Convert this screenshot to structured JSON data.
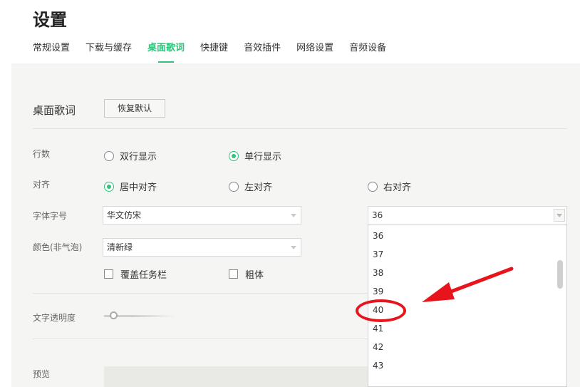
{
  "page_title": "设置",
  "tabs": [
    {
      "label": "常规设置"
    },
    {
      "label": "下载与缓存"
    },
    {
      "label": "桌面歌词"
    },
    {
      "label": "快捷键"
    },
    {
      "label": "音效插件"
    },
    {
      "label": "网络设置"
    },
    {
      "label": "音频设备"
    }
  ],
  "active_tab_index": 2,
  "section": {
    "title": "桌面歌词",
    "reset_button": "恢复默认"
  },
  "rows": {
    "line_count": {
      "label": "行数",
      "options": [
        "双行显示",
        "单行显示"
      ],
      "selected": "单行显示"
    },
    "align": {
      "label": "对齐",
      "options": [
        "居中对齐",
        "左对齐",
        "右对齐"
      ],
      "selected": "居中对齐"
    },
    "font": {
      "label": "字体字号",
      "font_value": "华文仿宋",
      "size_value": "36"
    },
    "color": {
      "label": "颜色(非气泡)",
      "value": "清新绿"
    },
    "checkboxes": [
      {
        "label": "覆盖任务栏",
        "checked": false
      },
      {
        "label": "粗体",
        "checked": false
      }
    ],
    "opacity": {
      "label": "文字透明度",
      "value_fraction": 0.1
    },
    "preview": {
      "label": "预览"
    }
  },
  "size_dropdown": {
    "options": [
      "36",
      "37",
      "38",
      "39",
      "40",
      "41",
      "42",
      "43"
    ],
    "highlighted": "40"
  },
  "annotation": {
    "color": "#e8141b"
  },
  "colors": {
    "accent": "#31c27c",
    "panel_bg": "#f5f5f3"
  }
}
